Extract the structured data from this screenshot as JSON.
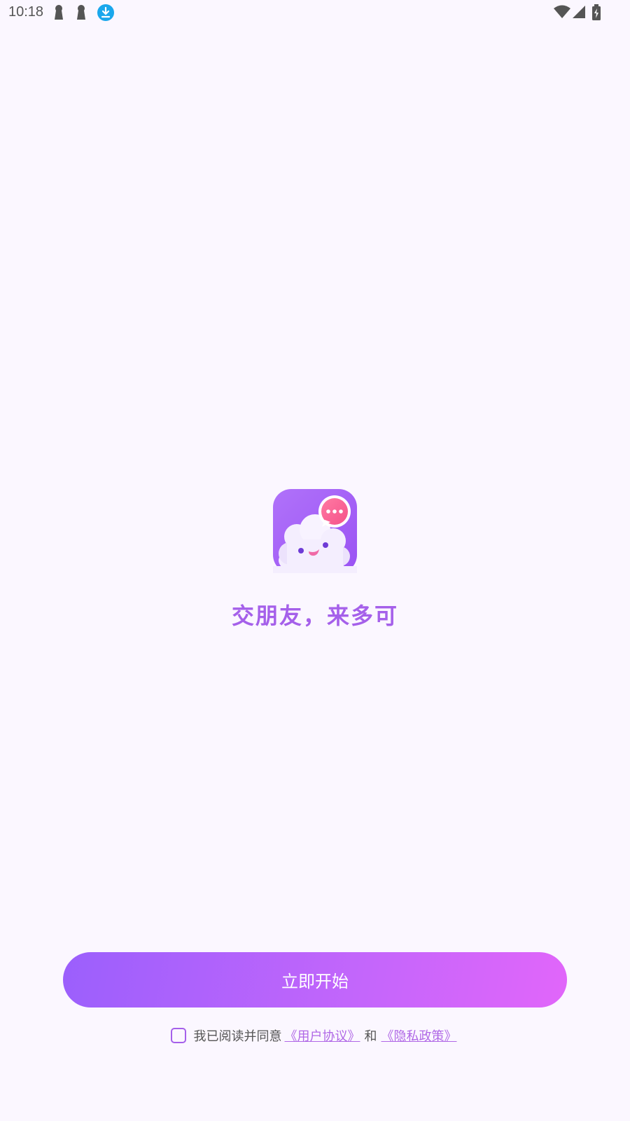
{
  "status_bar": {
    "time": "10:18",
    "left_icons": [
      "keyhole-icon",
      "keyhole-icon",
      "download-icon"
    ],
    "right_icons": [
      "wifi-icon",
      "cell-signal-icon",
      "battery-charging-icon"
    ],
    "download_icon_color": "#1aa7ec"
  },
  "splash": {
    "logo_icon": "cloud-mascot-chat-icon",
    "slogan": "交朋友，来多可"
  },
  "start_button": {
    "label": "立即开始"
  },
  "agreement": {
    "checked": false,
    "prefix": "我已阅读并同意",
    "user_agreement": "《用户协议》",
    "and": "和",
    "privacy_policy": "《隐私政策》"
  },
  "colors": {
    "background": "#fbf7ff",
    "accent": "#a560ea",
    "button_gradient_start": "#9b5ffc",
    "button_gradient_end": "#e166fa",
    "link": "#b068e6"
  }
}
